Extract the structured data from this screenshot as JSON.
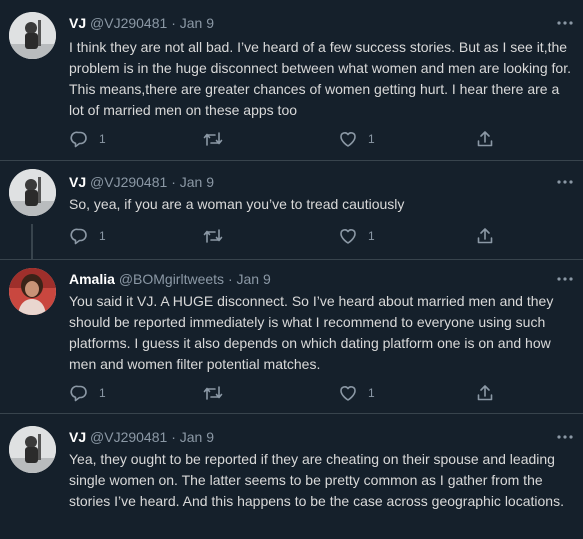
{
  "tweets": [
    {
      "name": "VJ",
      "handle": "@VJ290481",
      "dot": "·",
      "date": "Jan 9",
      "text": "I think they are not all bad. I’ve heard of a few success stories. But as I see it,the problem is in the huge disconnect between what women and men are looking for. This means,there are greater chances of women getting hurt. I hear there are a lot of married men on these apps too",
      "replies": "1",
      "retweets": "",
      "likes": "1"
    },
    {
      "name": "VJ",
      "handle": "@VJ290481",
      "dot": "·",
      "date": "Jan 9",
      "text": "So, yea, if you are a woman you’ve to tread cautiously",
      "replies": "1",
      "retweets": "",
      "likes": "1"
    },
    {
      "name": "Amalia",
      "handle": "@BOMgirltweets",
      "dot": "·",
      "date": "Jan 9",
      "text": "You said it VJ. A HUGE disconnect. So I’ve heard about married men and they should be reported immediately is what I recommend to everyone using such platforms. I guess it also depends on which dating platform one is on and how men and women filter potential matches.",
      "replies": "1",
      "retweets": "",
      "likes": "1"
    },
    {
      "name": "VJ",
      "handle": "@VJ290481",
      "dot": "·",
      "date": "Jan 9",
      "text": "Yea, they ought to be reported if they are cheating on their spouse and leading single women on. The latter seems to be pretty common as I gather from the stories I’ve heard. And this happens to be the case across geographic locations.",
      "replies": "",
      "retweets": "",
      "likes": ""
    }
  ],
  "icons": {
    "reply": "reply-icon",
    "retweet": "retweet-icon",
    "like": "heart-icon",
    "share": "share-icon",
    "more": "more-icon"
  },
  "colors": {
    "background": "#15202b",
    "text": "#d9d9d9",
    "secondary": "#8b98a5",
    "border": "#38444d"
  }
}
